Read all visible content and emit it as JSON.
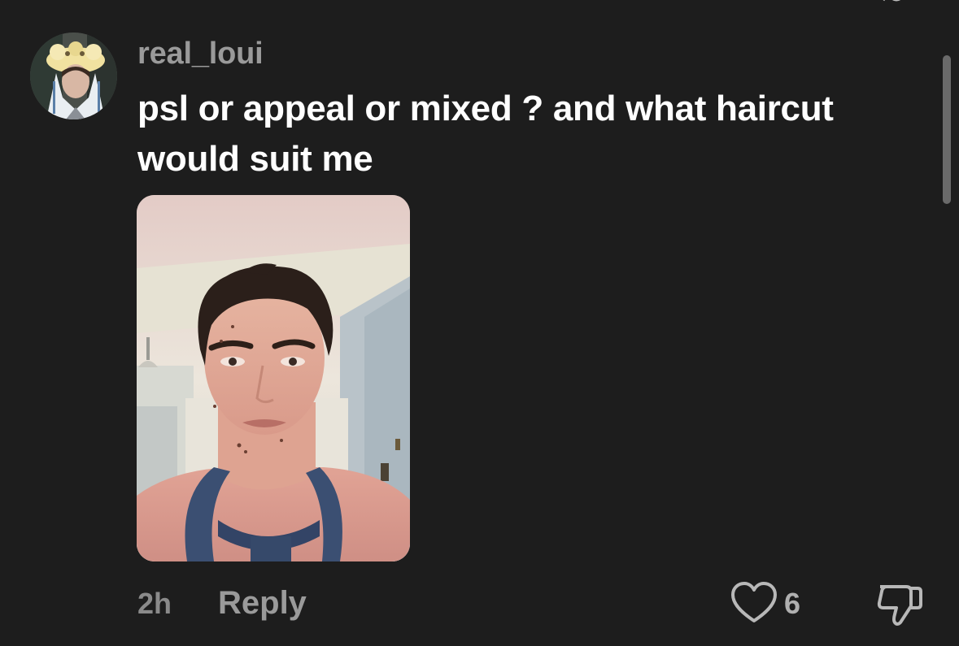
{
  "comment": {
    "username": "real_loui",
    "text_line1": "psl or appeal or mixed ? and what haircut",
    "text_line2": "would suit me",
    "timestamp": "2h",
    "reply_label": "Reply",
    "like_count": "6"
  },
  "icons": {
    "like": "heart-outline-icon",
    "dislike": "thumbs-down-icon"
  },
  "colors": {
    "background": "#1d1d1d",
    "username": "#9a9a9a",
    "text": "#ffffff",
    "secondary": "#8a8a8a"
  }
}
